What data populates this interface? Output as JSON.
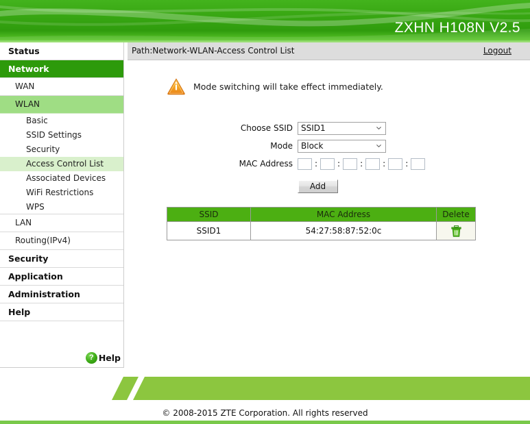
{
  "header": {
    "title": "ZXHN H108N V2.5",
    "brand_green": "#2f9c0d"
  },
  "sidebar": {
    "items": [
      {
        "label": "Status",
        "level": 1,
        "active": false,
        "name": "sidebar-item-status"
      },
      {
        "label": "Network",
        "level": 1,
        "active": true,
        "name": "sidebar-item-network"
      },
      {
        "label": "WAN",
        "level": 2,
        "active": false,
        "name": "sidebar-item-wan"
      },
      {
        "label": "WLAN",
        "level": 2,
        "active": true,
        "name": "sidebar-item-wlan"
      },
      {
        "label": "Basic",
        "level": 3,
        "active": false,
        "name": "sidebar-item-basic"
      },
      {
        "label": "SSID Settings",
        "level": 3,
        "active": false,
        "name": "sidebar-item-ssid-settings"
      },
      {
        "label": "Security",
        "level": 3,
        "active": false,
        "name": "sidebar-item-wlan-security"
      },
      {
        "label": "Access Control List",
        "level": 3,
        "active": true,
        "name": "sidebar-item-access-control-list"
      },
      {
        "label": "Associated Devices",
        "level": 3,
        "active": false,
        "name": "sidebar-item-associated-devices"
      },
      {
        "label": "WiFi Restrictions",
        "level": 3,
        "active": false,
        "name": "sidebar-item-wifi-restrictions"
      },
      {
        "label": "WPS",
        "level": 3,
        "active": false,
        "name": "sidebar-item-wps"
      },
      {
        "label": "LAN",
        "level": 2,
        "active": false,
        "name": "sidebar-item-lan"
      },
      {
        "label": "Routing(IPv4)",
        "level": 2,
        "active": false,
        "name": "sidebar-item-routing-ipv4"
      },
      {
        "label": "Security",
        "level": 1,
        "active": false,
        "name": "sidebar-item-security"
      },
      {
        "label": "Application",
        "level": 1,
        "active": false,
        "name": "sidebar-item-application"
      },
      {
        "label": "Administration",
        "level": 1,
        "active": false,
        "name": "sidebar-item-administration"
      },
      {
        "label": "Help",
        "level": 1,
        "active": false,
        "name": "sidebar-item-help"
      }
    ],
    "help_badge": {
      "glyph": "?",
      "label": "Help"
    }
  },
  "pathbar": {
    "path": "Path:Network-WLAN-Access Control List",
    "logout": "Logout"
  },
  "notice": {
    "icon": "warning-icon",
    "text": "Mode switching will take effect immediately.",
    "icon_color": "#f59b17"
  },
  "form": {
    "ssid": {
      "label": "Choose SSID",
      "value": "SSID1",
      "options": [
        "SSID1"
      ]
    },
    "mode": {
      "label": "Mode",
      "value": "Block",
      "options": [
        "Block"
      ]
    },
    "mac": {
      "label": "MAC Address",
      "separator": ":",
      "octets": [
        "",
        "",
        "",
        "",
        "",
        ""
      ]
    },
    "add_button": "Add"
  },
  "table": {
    "columns": [
      "SSID",
      "MAC Address",
      "Delete"
    ],
    "rows": [
      {
        "ssid": "SSID1",
        "mac": "54:27:58:87:52:0c",
        "delete_icon": "trash-icon"
      }
    ],
    "header_color": "#4caf12"
  },
  "footer": {
    "copyright": "© 2008-2015 ZTE Corporation. All rights reserved",
    "band_color": "#8cc63f"
  }
}
